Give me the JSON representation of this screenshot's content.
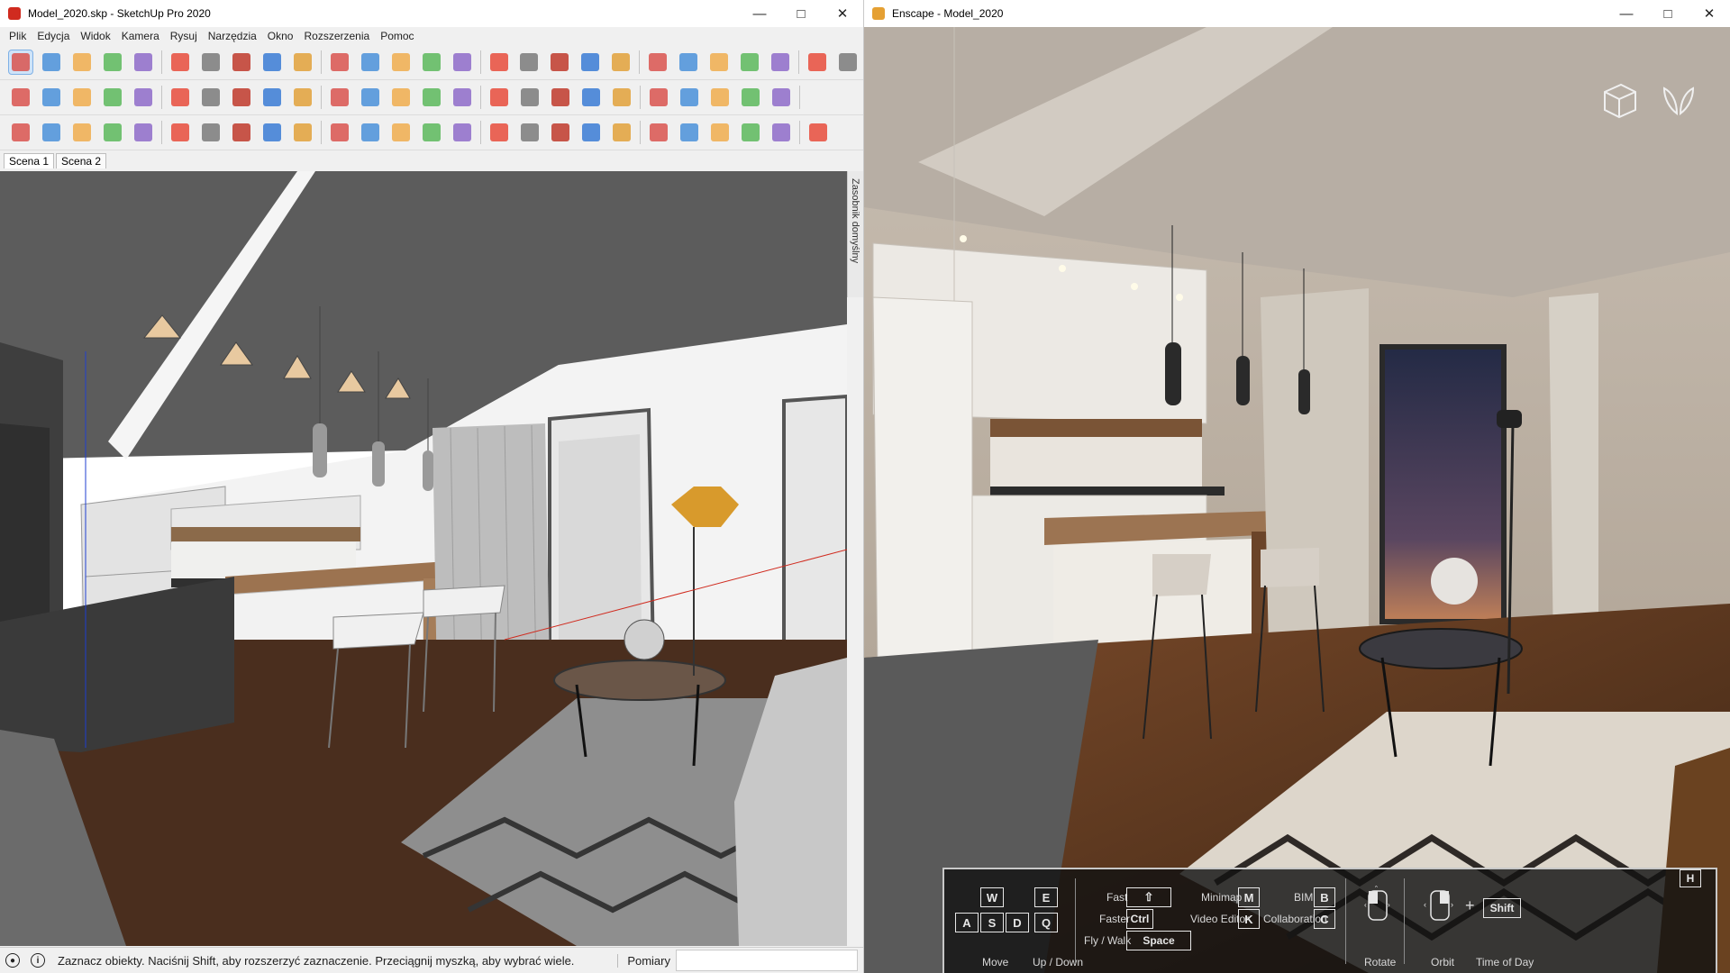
{
  "sketchup": {
    "title": "Model_2020.skp - SketchUp Pro 2020",
    "menu": [
      "Plik",
      "Edycja",
      "Widok",
      "Kamera",
      "Rysuj",
      "Narzędzia",
      "Okno",
      "Rozszerzenia",
      "Pomoc"
    ],
    "scenes": [
      "Scena 1",
      "Scena 2"
    ],
    "tray_label": "Zasobnik domyślny",
    "status_text": "Zaznacz obiekty. Naciśnij Shift, aby rozszerzyć zaznaczenie. Przeciągnij myszką, aby wybrać wiele.",
    "measurements_label": "Pomiary",
    "window_controls": [
      "minimize-icon",
      "maximize-icon",
      "close-icon"
    ],
    "toolbar_icons_row1": [
      "select-icon",
      "eraser-icon",
      "pencil-icon",
      "dropdown-icon",
      "arc-icon",
      "dropdown-icon",
      "rectangle-icon",
      "dropdown-icon",
      "push-pull-icon",
      "follow-me-icon",
      "move-icon",
      "rotate-icon",
      "scale-icon",
      "tape-measure-icon",
      "text-icon",
      "paint-bucket-icon",
      "orbit-icon",
      "pan-icon",
      "zoom-icon",
      "zoom-extents-icon",
      "warehouse-icon",
      "extension-warehouse-icon",
      "layout-icon",
      "validate-icon",
      "section-plane-icon",
      "sandbox-icon",
      "style-icon"
    ],
    "toolbar_icons_row2": [
      "select-icon",
      "scale-icon",
      "scale-icon",
      "align-icon",
      "align-icon",
      "align-icon",
      "line-icon",
      "line-icon",
      "line-icon",
      "grid-icon",
      "grid-icon",
      "grid-icon",
      "grid-icon",
      "grid-icon",
      "grid-icon",
      "texture-icon",
      "texture-icon",
      "component-icon",
      "contrast-icon",
      "group-icon",
      "group-icon",
      "settings-icon",
      "paint-icon",
      "curve-icon",
      "sphere-icon"
    ],
    "toolbar_icons_row3": [
      "view-iso-icon",
      "view-top-icon",
      "view-front-icon",
      "view-right-icon",
      "section-icon",
      "terrain-icon",
      "tool-icon",
      "tool-icon",
      "tool-icon",
      "tool-icon",
      "tool-icon",
      "tool-icon",
      "tool-icon",
      "tool-icon",
      "tool-icon",
      "bucket-icon",
      "render-icon",
      "crosshair-icon",
      "shirt-icon",
      "transform-icon",
      "shell-icon",
      "flask-icon",
      "gear-icon",
      "ruler-icon",
      "color-icon",
      "brick-icon"
    ]
  },
  "enscape": {
    "title": "Enscape - Model_2020",
    "hud_icons": [
      "views-cube-icon",
      "wings-icon"
    ],
    "help": {
      "toggle_key": "H",
      "move_keys": [
        "W",
        "A",
        "S",
        "D"
      ],
      "updown_keys": [
        "E",
        "Q"
      ],
      "move_label": "Move",
      "updown_label": "Up / Down",
      "fast_label": "Fast",
      "fast_key_icon": "shift-arrow-icon",
      "faster_label": "Faster",
      "faster_key": "Ctrl",
      "flywalk_label": "Fly /  Walk",
      "flywalk_key": "Space",
      "minimap_label": "Minimap",
      "minimap_key": "M",
      "video_editor_label": "Video Editor",
      "video_editor_key": "K",
      "bim_label": "BIM",
      "bim_key": "B",
      "collab_label": "Collaboration",
      "collab_key": "C",
      "rotate_label": "Rotate",
      "orbit_label": "Orbit",
      "plus": "+",
      "shift_key": "Shift",
      "time_label": "Time of Day"
    }
  },
  "colors": {
    "sketchup_accent": "#d02b1f",
    "enscape_accent": "#e5a033",
    "floor_wood": "#4a2e1e",
    "ceiling_dark": "#5c5c5c"
  }
}
